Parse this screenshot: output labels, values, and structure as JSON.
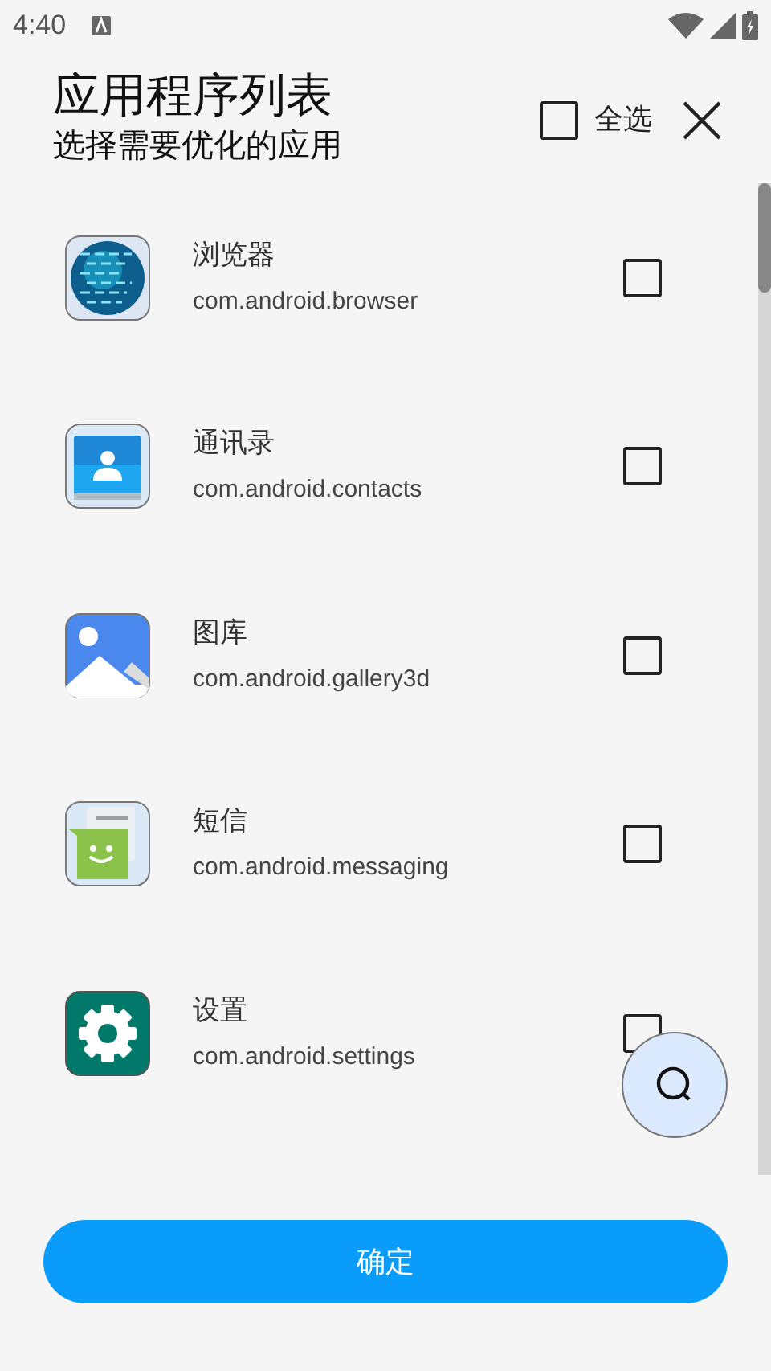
{
  "status_bar": {
    "time": "4:40"
  },
  "header": {
    "title": "应用程序列表",
    "subtitle": "选择需要优化的应用",
    "select_all": {
      "label": "全选",
      "checked": false
    }
  },
  "apps": [
    {
      "kind": "browser",
      "name": "浏览器",
      "package": "com.android.browser",
      "checked": false
    },
    {
      "kind": "contacts",
      "name": "通讯录",
      "package": "com.android.contacts",
      "checked": false
    },
    {
      "kind": "gallery",
      "name": "图库",
      "package": "com.android.gallery3d",
      "checked": false
    },
    {
      "kind": "messaging",
      "name": "短信",
      "package": "com.android.messaging",
      "checked": false
    },
    {
      "kind": "settings",
      "name": "设置",
      "package": "com.android.settings",
      "checked": false
    }
  ],
  "confirm_button": "确定"
}
